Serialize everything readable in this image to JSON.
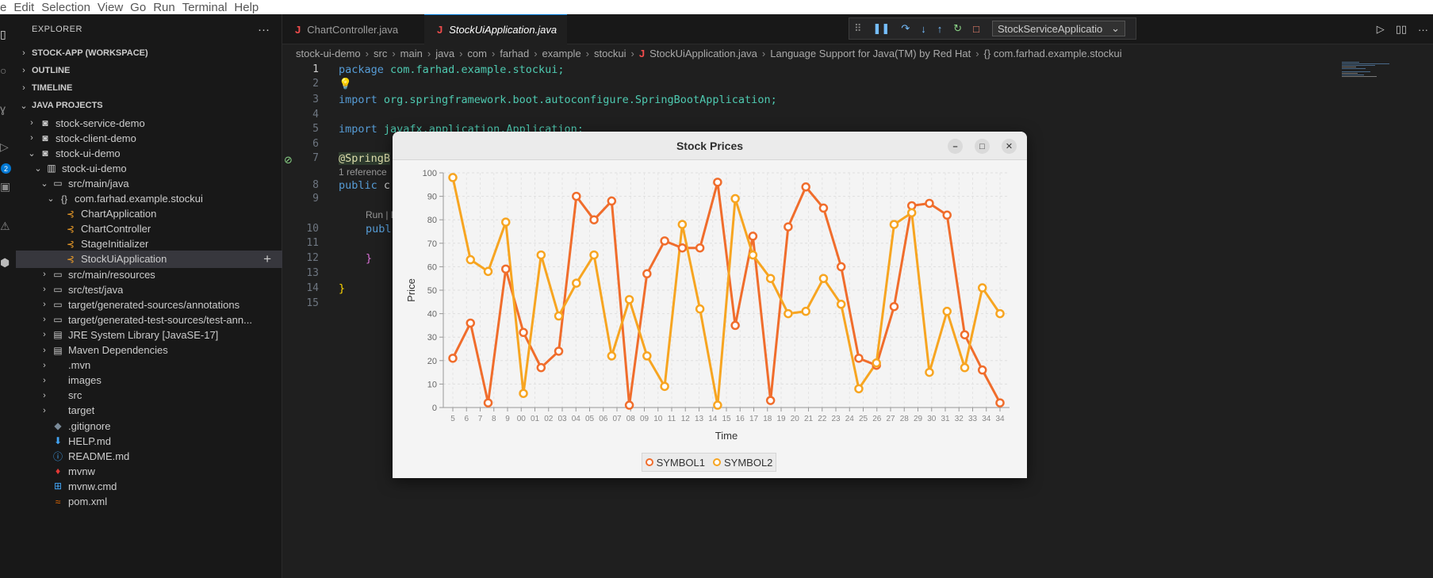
{
  "menu": {
    "items": [
      "e",
      "Edit",
      "Selection",
      "View",
      "Go",
      "Run",
      "Terminal",
      "Help"
    ]
  },
  "activity": {
    "badge": "2",
    "icons": [
      "files-icon",
      "search-icon",
      "source-control-icon",
      "run-debug-icon",
      "extensions-icon",
      "testing-icon",
      "java-projects-icon"
    ]
  },
  "sidebar": {
    "title": "EXPLORER",
    "more": "···",
    "workspace": "STOCK-APP (WORKSPACE)",
    "outline": "OUTLINE",
    "timeline": "TIMELINE",
    "java_projects": "JAVA PROJECTS",
    "tree": [
      {
        "label": "stock-service-demo",
        "icon": "project-icon"
      },
      {
        "label": "stock-client-demo",
        "icon": "project-icon"
      },
      {
        "label": "stock-ui-demo",
        "icon": "project-icon"
      },
      {
        "label": "stock-ui-demo",
        "icon": "module-icon"
      },
      {
        "label": "src/main/java",
        "icon": "package-folder-icon"
      },
      {
        "label": "com.farhad.example.stockui",
        "icon": "package-icon"
      },
      {
        "label": "ChartApplication",
        "icon": "class-icon"
      },
      {
        "label": "ChartController",
        "icon": "class-icon"
      },
      {
        "label": "StageInitializer",
        "icon": "class-icon"
      },
      {
        "label": "StockUiApplication",
        "icon": "class-icon"
      },
      {
        "label": "src/main/resources",
        "icon": "package-folder-icon"
      },
      {
        "label": "src/test/java",
        "icon": "package-folder-icon"
      },
      {
        "label": "target/generated-sources/annotations",
        "icon": "package-folder-icon"
      },
      {
        "label": "target/generated-test-sources/test-ann...",
        "icon": "package-folder-icon"
      },
      {
        "label": "JRE System Library [JavaSE-17]",
        "icon": "library-icon"
      },
      {
        "label": "Maven Dependencies",
        "icon": "library-icon"
      },
      {
        "label": ".mvn",
        "icon": "folder-icon"
      },
      {
        "label": "images",
        "icon": "folder-icon"
      },
      {
        "label": "src",
        "icon": "folder-icon"
      },
      {
        "label": "target",
        "icon": "folder-icon"
      },
      {
        "label": ".gitignore",
        "icon": "git-icon"
      },
      {
        "label": "HELP.md",
        "icon": "markdown-icon"
      },
      {
        "label": "README.md",
        "icon": "info-icon"
      },
      {
        "label": "mvnw",
        "icon": "shell-icon"
      },
      {
        "label": "mvnw.cmd",
        "icon": "windows-icon"
      },
      {
        "label": "pom.xml",
        "icon": "rss-icon"
      }
    ]
  },
  "tabs": [
    {
      "label": "ChartController.java",
      "active": false
    },
    {
      "label": "StockUiApplication.java",
      "active": true
    }
  ],
  "debug": {
    "config": "StockServiceApplicatio",
    "caret": "⌄"
  },
  "breadcrumb": [
    "stock-ui-demo",
    "src",
    "main",
    "java",
    "com",
    "farhad",
    "example",
    "stockui",
    "StockUiApplication.java",
    "Language Support for Java(TM) by Red Hat",
    "{} com.farhad.example.stockui"
  ],
  "editor": {
    "line_numbers": [
      "1",
      "2",
      "3",
      "4",
      "5",
      "6",
      "7",
      "8",
      "9",
      "10",
      "11",
      "12",
      "13",
      "14",
      "15"
    ],
    "line1_kw": "package",
    "line1_rest": " com.farhad.example.stockui;",
    "line3_kw": "import",
    "line3_rest": " org.springframework.boot.autoconfigure.SpringBootApplication;",
    "line5_kw": "import",
    "line5_rest": " javafx.application.Application;",
    "line7": "@SpringB",
    "codelens_refs": "1 reference",
    "line8_kw": "public",
    "line8_rest": " c",
    "codelens_run": "Run | D",
    "line10_kw": "publ",
    "line13": "}",
    "line14": "}"
  },
  "window": {
    "title": "Stock Prices",
    "minimize": "–",
    "maximize": "□",
    "close": "✕"
  },
  "chart_data": {
    "type": "line",
    "title": "",
    "xlabel": "Time",
    "ylabel": "Price",
    "ylim": [
      0,
      100
    ],
    "yticks": [
      0,
      10,
      20,
      30,
      40,
      50,
      60,
      70,
      80,
      90,
      100
    ],
    "x_tick_labels": [
      "5",
      "6",
      "7",
      "8",
      "9",
      "00",
      "01",
      "02",
      "03",
      "04",
      "05",
      "06",
      "07",
      "08",
      "09",
      "10",
      "11",
      "12",
      "13",
      "14",
      "15",
      "16",
      "17",
      "18",
      "19",
      "20",
      "21",
      "22",
      "23",
      "24",
      "25",
      "26",
      "27",
      "28",
      "29",
      "30",
      "31",
      "32",
      "33",
      "34",
      "34"
    ],
    "grid": true,
    "legend": "bottom-center",
    "series": [
      {
        "name": "SYMBOL1",
        "color": "#f06d2c",
        "values": [
          21,
          36,
          2,
          59,
          32,
          17,
          24,
          90,
          80,
          88,
          1,
          57,
          71,
          68,
          68,
          96,
          35,
          73,
          3,
          77,
          94,
          85,
          60,
          21,
          18,
          43,
          86,
          87,
          82,
          31,
          16,
          2
        ]
      },
      {
        "name": "SYMBOL2",
        "color": "#f7a521",
        "values": [
          98,
          63,
          58,
          79,
          6,
          65,
          39,
          53,
          65,
          22,
          46,
          22,
          9,
          78,
          42,
          1,
          89,
          65,
          55,
          40,
          41,
          55,
          44,
          8,
          19,
          78,
          83,
          15,
          41,
          17,
          51,
          40
        ]
      }
    ]
  }
}
